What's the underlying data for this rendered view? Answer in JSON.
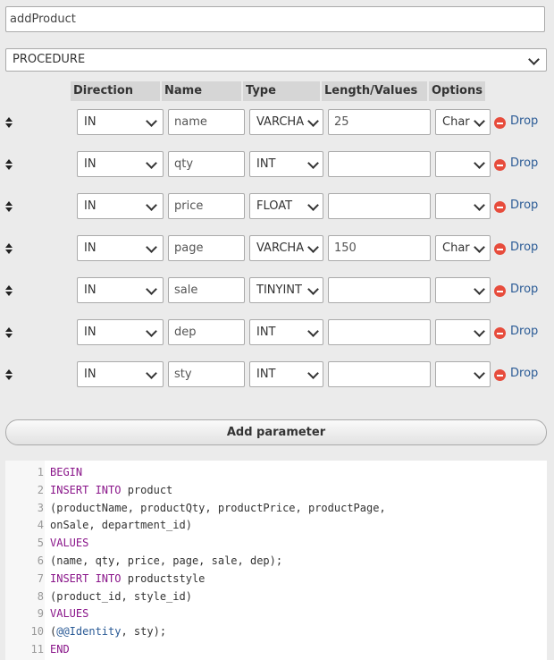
{
  "routine": {
    "name_value": "addProduct",
    "type_value": "PROCEDURE"
  },
  "params_header": {
    "direction": "Direction",
    "name": "Name",
    "type": "Type",
    "length": "Length/Values",
    "options": "Options"
  },
  "params": [
    {
      "direction": "IN",
      "name": "name",
      "type": "VARCHA",
      "length": "25",
      "options": "Char",
      "drop": "Drop"
    },
    {
      "direction": "IN",
      "name": "qty",
      "type": "INT",
      "length": "",
      "options": "",
      "drop": "Drop"
    },
    {
      "direction": "IN",
      "name": "price",
      "type": "FLOAT",
      "length": "",
      "options": "",
      "drop": "Drop"
    },
    {
      "direction": "IN",
      "name": "page",
      "type": "VARCHA",
      "length": "150",
      "options": "Char",
      "drop": "Drop"
    },
    {
      "direction": "IN",
      "name": "sale",
      "type": "TINYINT",
      "length": "",
      "options": "",
      "drop": "Drop"
    },
    {
      "direction": "IN",
      "name": "dep",
      "type": "INT",
      "length": "",
      "options": "",
      "drop": "Drop"
    },
    {
      "direction": "IN",
      "name": "sty",
      "type": "INT",
      "length": "",
      "options": "",
      "drop": "Drop"
    }
  ],
  "add_parameter_label": "Add parameter",
  "code": {
    "lines": [
      {
        "n": "1",
        "parts": [
          {
            "t": "BEGIN",
            "k": "kw"
          }
        ]
      },
      {
        "n": "2",
        "parts": [
          {
            "t": "INSERT INTO",
            "k": "kw"
          },
          {
            "t": " product",
            "k": ""
          }
        ]
      },
      {
        "n": "3",
        "parts": [
          {
            "t": "(productName, productQty, productPrice, productPage,",
            "k": ""
          }
        ]
      },
      {
        "n": "4",
        "parts": [
          {
            "t": "onSale, department_id)",
            "k": ""
          }
        ]
      },
      {
        "n": "5",
        "parts": [
          {
            "t": "VALUES",
            "k": "kw"
          }
        ]
      },
      {
        "n": "6",
        "parts": [
          {
            "t": "(name, qty, price, page, sale, dep);",
            "k": ""
          }
        ]
      },
      {
        "n": "7",
        "parts": [
          {
            "t": "INSERT INTO",
            "k": "kw"
          },
          {
            "t": " productstyle",
            "k": ""
          }
        ]
      },
      {
        "n": "8",
        "parts": [
          {
            "t": "(product_id, style_id)",
            "k": ""
          }
        ]
      },
      {
        "n": "9",
        "parts": [
          {
            "t": "VALUES",
            "k": "kw"
          }
        ]
      },
      {
        "n": "10",
        "parts": [
          {
            "t": "(",
            "k": ""
          },
          {
            "t": "@@Identity",
            "k": "var"
          },
          {
            "t": ", sty);",
            "k": ""
          }
        ]
      },
      {
        "n": "11",
        "parts": [
          {
            "t": "END",
            "k": "kw"
          }
        ]
      }
    ]
  },
  "icons": {
    "drag": "drag-handle-icon",
    "drop": "minus-circle-icon",
    "dropdown": "chevron-down-icon"
  },
  "colors": {
    "drop_icon": "#e74c3c",
    "link": "#2b5b96",
    "keyword": "#8a168a"
  }
}
